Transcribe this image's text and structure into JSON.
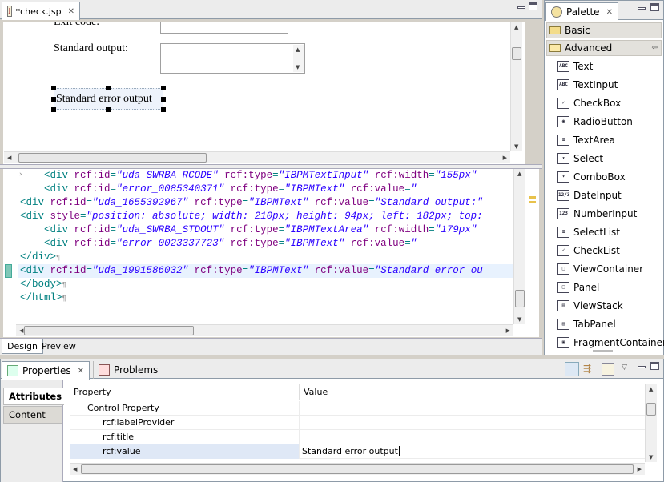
{
  "editor": {
    "tab_title": "*check.jsp",
    "canvas": {
      "exit_code_label": "Exit code:",
      "stdout_label": "Standard output:",
      "stderr_text": "Standard error output"
    },
    "source_lines": [
      {
        "indent": "    ",
        "parts": [
          [
            "t",
            "<div "
          ],
          [
            "a",
            "rcf:id"
          ],
          [
            "t",
            "="
          ],
          [
            "v",
            "\"uda_SWRBA_RCODE\""
          ],
          [
            "t",
            " "
          ],
          [
            "a",
            "rcf:type"
          ],
          [
            "t",
            "="
          ],
          [
            "v",
            "\"IBPMTextInput\""
          ],
          [
            "t",
            " "
          ],
          [
            "a",
            "rcf:width"
          ],
          [
            "t",
            "="
          ],
          [
            "v",
            "\"155px\""
          ]
        ]
      },
      {
        "indent": "    ",
        "parts": [
          [
            "t",
            "<div "
          ],
          [
            "a",
            "rcf:id"
          ],
          [
            "t",
            "="
          ],
          [
            "v",
            "\"error_0085340371\""
          ],
          [
            "t",
            " "
          ],
          [
            "a",
            "rcf:type"
          ],
          [
            "t",
            "="
          ],
          [
            "v",
            "\"IBPMText\""
          ],
          [
            "t",
            " "
          ],
          [
            "a",
            "rcf:value"
          ],
          [
            "t",
            "="
          ],
          [
            "v",
            "\""
          ]
        ]
      },
      {
        "indent": "",
        "parts": [
          [
            "t",
            "<div "
          ],
          [
            "a",
            "rcf:id"
          ],
          [
            "t",
            "="
          ],
          [
            "v",
            "\"uda_1655392967\""
          ],
          [
            "t",
            " "
          ],
          [
            "a",
            "rcf:type"
          ],
          [
            "t",
            "="
          ],
          [
            "v",
            "\"IBPMText\""
          ],
          [
            "t",
            " "
          ],
          [
            "a",
            "rcf:value"
          ],
          [
            "t",
            "="
          ],
          [
            "v",
            "\"Standard output:\""
          ]
        ]
      },
      {
        "indent": "",
        "parts": [
          [
            "t",
            "<div "
          ],
          [
            "a",
            "style"
          ],
          [
            "t",
            "="
          ],
          [
            "v",
            "\"position: absolute; width: 210px; height: 94px; left: 182px; top:"
          ]
        ]
      },
      {
        "indent": "    ",
        "parts": [
          [
            "t",
            "<div "
          ],
          [
            "a",
            "rcf:id"
          ],
          [
            "t",
            "="
          ],
          [
            "v",
            "\"uda_SWRBA_STDOUT\""
          ],
          [
            "t",
            " "
          ],
          [
            "a",
            "rcf:type"
          ],
          [
            "t",
            "="
          ],
          [
            "v",
            "\"IBPMTextArea\""
          ],
          [
            "t",
            " "
          ],
          [
            "a",
            "rcf:width"
          ],
          [
            "t",
            "="
          ],
          [
            "v",
            "\"179px\""
          ]
        ]
      },
      {
        "indent": "    ",
        "parts": [
          [
            "t",
            "<div "
          ],
          [
            "a",
            "rcf:id"
          ],
          [
            "t",
            "="
          ],
          [
            "v",
            "\"error_0023337723\""
          ],
          [
            "t",
            " "
          ],
          [
            "a",
            "rcf:type"
          ],
          [
            "t",
            "="
          ],
          [
            "v",
            "\"IBPMText\""
          ],
          [
            "t",
            " "
          ],
          [
            "a",
            "rcf:value"
          ],
          [
            "t",
            "="
          ],
          [
            "v",
            "\""
          ]
        ]
      },
      {
        "indent": "",
        "parts": [
          [
            "t",
            "</div>"
          ],
          [
            "p",
            "¶"
          ]
        ]
      },
      {
        "indent": "",
        "parts": [
          [
            "t",
            "<div "
          ],
          [
            "a",
            "rcf:id"
          ],
          [
            "t",
            "="
          ],
          [
            "v",
            "\"uda_1991586032\""
          ],
          [
            "t",
            " "
          ],
          [
            "a",
            "rcf:type"
          ],
          [
            "t",
            "="
          ],
          [
            "v",
            "\"IBPMText\""
          ],
          [
            "t",
            " "
          ],
          [
            "a",
            "rcf:value"
          ],
          [
            "t",
            "="
          ],
          [
            "v",
            "\"Standard error ou"
          ]
        ]
      },
      {
        "indent": "",
        "parts": [
          [
            "t",
            "</body>"
          ],
          [
            "p",
            "¶"
          ]
        ]
      },
      {
        "indent": "",
        "parts": [
          [
            "t",
            "</html>"
          ],
          [
            "p",
            "¶"
          ]
        ]
      }
    ],
    "bottom_tabs": [
      "Design",
      "Preview"
    ]
  },
  "palette": {
    "title": "Palette",
    "groups": [
      "Basic",
      "Advanced"
    ],
    "items": [
      {
        "label": "Text",
        "icon": "ABC"
      },
      {
        "label": "TextInput",
        "icon": "ABC"
      },
      {
        "label": "CheckBox",
        "icon": "✓"
      },
      {
        "label": "RadioButton",
        "icon": "◉"
      },
      {
        "label": "TextArea",
        "icon": "≡"
      },
      {
        "label": "Select",
        "icon": "▾"
      },
      {
        "label": "ComboBox",
        "icon": "▾"
      },
      {
        "label": "DateInput",
        "icon": "12/3"
      },
      {
        "label": "NumberInput",
        "icon": "123"
      },
      {
        "label": "SelectList",
        "icon": "≡"
      },
      {
        "label": "CheckList",
        "icon": "✓"
      },
      {
        "label": "ViewContainer",
        "icon": "□"
      },
      {
        "label": "Panel",
        "icon": "□"
      },
      {
        "label": "ViewStack",
        "icon": "▤"
      },
      {
        "label": "TabPanel",
        "icon": "▤"
      },
      {
        "label": "FragmentContainer",
        "icon": "▣"
      }
    ]
  },
  "properties": {
    "tab_title": "Properties",
    "problems_tab": "Problems",
    "side_tabs": [
      "Attributes",
      "Content"
    ],
    "columns": [
      "Property",
      "Value"
    ],
    "rows": [
      {
        "name": "Control Property",
        "value": "",
        "level": 1
      },
      {
        "name": "rcf:labelProvider",
        "value": "",
        "level": 2
      },
      {
        "name": "rcf:title",
        "value": "",
        "level": 2
      },
      {
        "name": "rcf:value",
        "value": "Standard error output",
        "level": 2
      }
    ]
  },
  "colors": {
    "selection": "#dfe8f6",
    "current_line": "#e8f2fe",
    "tag": "#008080",
    "attr": "#7f007f",
    "value": "#2a00ff"
  }
}
